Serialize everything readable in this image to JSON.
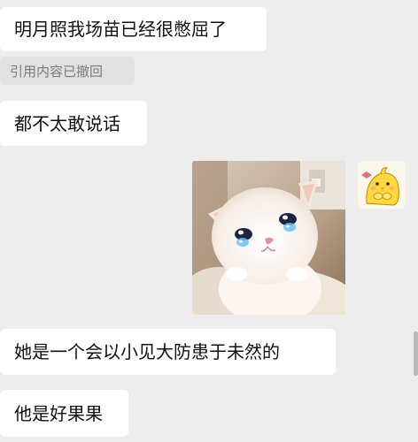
{
  "messages": [
    {
      "text": "明月照我场苗已经很憋屈了"
    },
    {
      "text": "引用内容已撤回"
    },
    {
      "text": "都不太敢说话"
    },
    {
      "text": "她是一个会以小见大防患于未然的"
    },
    {
      "text": "他是好果果"
    }
  ],
  "image_message": {
    "description_icon": "crying-kitten-icon"
  },
  "avatar": {
    "icon": "chick-sticker-icon"
  },
  "colors": {
    "background": "#ededed",
    "bubble": "#ffffff",
    "quote_bg": "#e1e1e1",
    "quote_text": "#7a7a7a"
  }
}
